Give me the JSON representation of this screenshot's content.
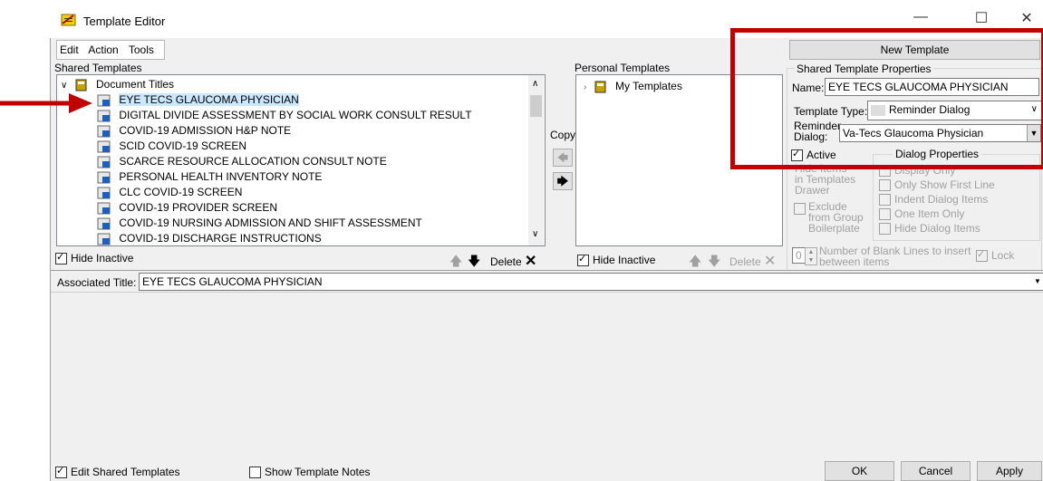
{
  "window": {
    "title": "Template Editor"
  },
  "menu": {
    "items": [
      "Edit",
      "Action",
      "Tools"
    ]
  },
  "shared": {
    "header": "Shared Templates",
    "root_label": "Document Titles",
    "items": [
      "EYE TECS GLAUCOMA PHYSICIAN",
      "DIGITAL DIVIDE ASSESSMENT BY SOCIAL WORK CONSULT RESULT",
      "COVID-19 ADMISSION H&P NOTE",
      "SCID COVID-19 SCREEN",
      "SCARCE RESOURCE ALLOCATION CONSULT NOTE",
      "PERSONAL HEALTH INVENTORY NOTE",
      "CLC COVID-19 SCREEN",
      "COVID-19 PROVIDER SCREEN",
      "COVID-19 NURSING ADMISSION AND SHIFT ASSESSMENT",
      "COVID-19 DISCHARGE INSTRUCTIONS"
    ],
    "hide_inactive": "Hide Inactive",
    "delete": "Delete"
  },
  "copy_label": "Copy",
  "personal": {
    "header": "Personal Templates",
    "root_label": "My Templates",
    "hide_inactive": "Hide Inactive",
    "delete": "Delete"
  },
  "props": {
    "new_template": "New Template",
    "group_title": "Shared Template Properties",
    "name_label": "Name:",
    "name_value": "EYE TECS GLAUCOMA PHYSICIAN",
    "type_label": "Template Type:",
    "type_value": "Reminder Dialog",
    "reminder_label_1": "Reminder",
    "reminder_label_2": "Dialog:",
    "reminder_value": "Va-Tecs Glaucoma Physician",
    "active": "Active",
    "hide_items_1": "Hide Items",
    "hide_items_2": "in Templates",
    "hide_items_3": "Drawer",
    "exclude_1": "Exclude",
    "exclude_2": "from Group",
    "exclude_3": "Boilerplate",
    "dialog_props_title": "Dialog Properties",
    "display_only": "Display Only",
    "only_first_line": "Only Show First Line",
    "indent_items": "Indent Dialog Items",
    "one_item_only": "One Item Only",
    "hide_dialog_items": "Hide Dialog Items",
    "blank_lines_value": "0",
    "blank_lines_1": "Number of Blank Lines to insert",
    "blank_lines_2": "between items",
    "lock": "Lock"
  },
  "associated": {
    "label": "Associated Title:",
    "value": "EYE TECS GLAUCOMA PHYSICIAN"
  },
  "footer": {
    "edit_shared": "Edit Shared Templates",
    "show_notes": "Show Template Notes",
    "ok": "OK",
    "cancel": "Cancel",
    "apply": "Apply"
  },
  "colors": {
    "annotation_red": "#c00000",
    "selection": "#cce8ff"
  }
}
